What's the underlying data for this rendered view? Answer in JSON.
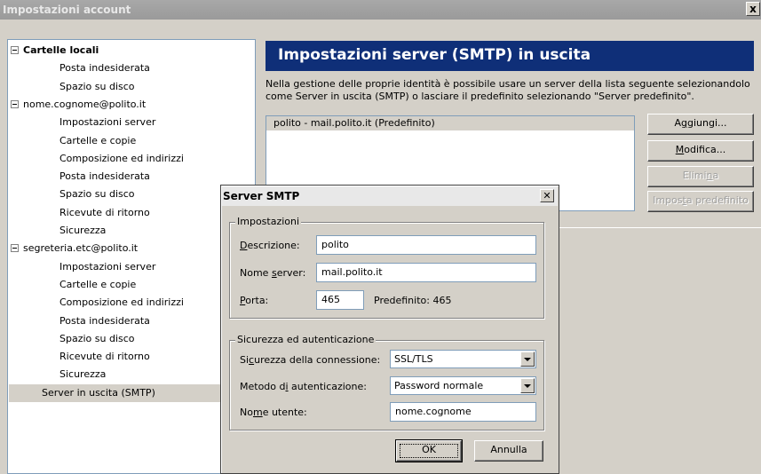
{
  "window": {
    "title": "Impostazioni account",
    "close_glyph": "x"
  },
  "tree": [
    {
      "label": "Cartelle locali",
      "level": 0,
      "toggle": true,
      "bold": true
    },
    {
      "label": "Posta indesiderata",
      "level": 1
    },
    {
      "label": "Spazio su disco",
      "level": 1
    },
    {
      "label": "nome.cognome@polito.it",
      "level": 0,
      "toggle": true
    },
    {
      "label": "Impostazioni server",
      "level": 1
    },
    {
      "label": "Cartelle e copie",
      "level": 1
    },
    {
      "label": "Composizione ed indirizzi",
      "level": 1
    },
    {
      "label": "Posta indesiderata",
      "level": 1
    },
    {
      "label": "Spazio su disco",
      "level": 1
    },
    {
      "label": "Ricevute di ritorno",
      "level": 1
    },
    {
      "label": "Sicurezza",
      "level": 1
    },
    {
      "label": "segreteria.etc@polito.it",
      "level": 0,
      "toggle": true
    },
    {
      "label": "Impostazioni server",
      "level": 1
    },
    {
      "label": "Cartelle e copie",
      "level": 1
    },
    {
      "label": "Composizione ed indirizzi",
      "level": 1
    },
    {
      "label": "Posta indesiderata",
      "level": 1
    },
    {
      "label": "Spazio su disco",
      "level": 1
    },
    {
      "label": "Ricevute di ritorno",
      "level": 1
    },
    {
      "label": "Sicurezza",
      "level": 1
    },
    {
      "label": "Server in uscita (SMTP)",
      "level": 0,
      "selected": true
    }
  ],
  "smtp_panel": {
    "header": "Impostazioni server (SMTP) in uscita",
    "description": "Nella gestione delle proprie identità è possibile usare un server della lista seguente selezionandolo come Server in uscita (SMTP) o lasciare il predefinito selezionando \"Server predefinito\".",
    "servers": [
      "polito - mail.polito.it (Predefinito)"
    ],
    "buttons": {
      "add": {
        "pre": "A",
        "u": "g",
        "post": "giungi..."
      },
      "edit": {
        "pre": "",
        "u": "M",
        "post": "odifica..."
      },
      "remove": {
        "pre": "Elimi",
        "u": "n",
        "post": "a"
      },
      "set_default": {
        "pre": "Impos",
        "u": "t",
        "post": "a predefinito"
      }
    }
  },
  "dialog": {
    "title": "Server SMTP",
    "close_glyph": "✕",
    "settings_group": "Impostazioni",
    "description_label": {
      "u": "D",
      "post": "escrizione:"
    },
    "description_value": "polito",
    "server_label": {
      "pre": "Nome ",
      "u": "s",
      "post": "erver:"
    },
    "server_value": "mail.polito.it",
    "port_label": {
      "u": "P",
      "post": "orta:"
    },
    "port_value": "465",
    "default_port": "Predefinito:  465",
    "security_group": "Sicurezza ed autenticazione",
    "conn_security_label": {
      "pre": "Si",
      "u": "c",
      "post": "urezza della connessione:"
    },
    "conn_security_value": "SSL/TLS",
    "auth_label": {
      "pre": "Metodo d",
      "u": "i",
      "post": " autenticazione:"
    },
    "auth_value": "Password normale",
    "username_label": {
      "pre": "No",
      "u": "m",
      "post": "e utente:"
    },
    "username_value": "nome.cognome",
    "ok": "OK",
    "cancel": "Annulla"
  }
}
